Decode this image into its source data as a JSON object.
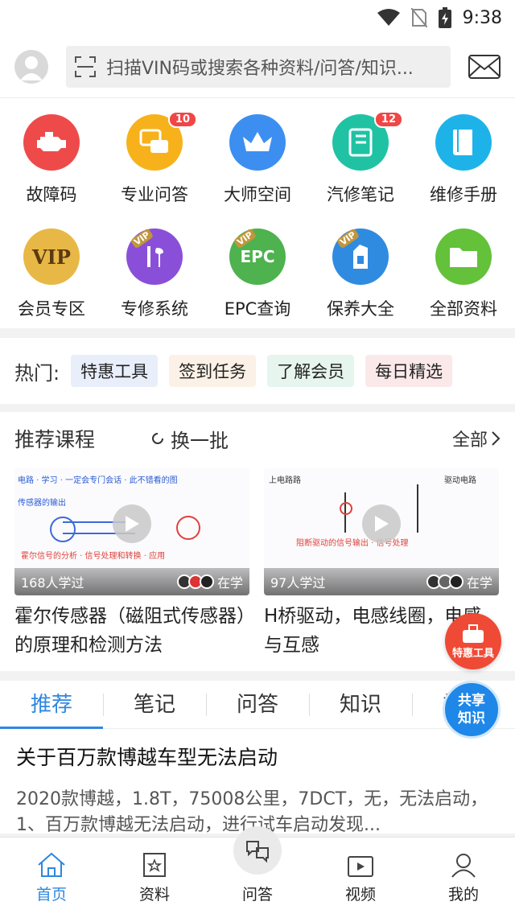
{
  "status_bar": {
    "time": "9:38"
  },
  "search": {
    "placeholder": "扫描VIN码或搜索各种资料/问答/知识..."
  },
  "grid": [
    {
      "label": "故障码",
      "icon": "engine-icon",
      "color": "#ee4a4a",
      "badge": ""
    },
    {
      "label": "专业问答",
      "icon": "chat-icon",
      "color": "#f7b21b",
      "badge": "10"
    },
    {
      "label": "大师空间",
      "icon": "crown-icon",
      "color": "#3c8ff0",
      "badge": ""
    },
    {
      "label": "汽修笔记",
      "icon": "notebook-icon",
      "color": "#1fc3a3",
      "badge": "12"
    },
    {
      "label": "维修手册",
      "icon": "book-icon",
      "color": "#1db3e8",
      "badge": ""
    },
    {
      "label": "会员专区",
      "icon": "vip-icon",
      "color": "#e8b846",
      "text": "VIP"
    },
    {
      "label": "专修系统",
      "icon": "tools-icon",
      "color": "#8a4fd8"
    },
    {
      "label": "EPC查询",
      "icon": "epc-icon",
      "color": "#4eb24e",
      "text": "EPC"
    },
    {
      "label": "保养大全",
      "icon": "oil-icon",
      "color": "#2f8be0"
    },
    {
      "label": "全部资料",
      "icon": "folder-icon",
      "color": "#63c13a"
    }
  ],
  "hot": {
    "title": "热门:",
    "chips": [
      {
        "label": "特惠工具",
        "bg": "#e9eefb",
        "color": "#444"
      },
      {
        "label": "签到任务",
        "bg": "#fbf1e6",
        "color": "#444"
      },
      {
        "label": "了解会员",
        "bg": "#e6f5ee",
        "color": "#444"
      },
      {
        "label": "每日精选",
        "bg": "#fbe9ea",
        "color": "#444"
      }
    ]
  },
  "courses": {
    "title": "推荐课程",
    "refresh": "换一批",
    "all": "全部",
    "items": [
      {
        "learners": "168人学过",
        "studying": "在学",
        "title": "霍尔传感器（磁阻式传感器）的原理和检测方法"
      },
      {
        "learners": "97人学过",
        "studying": "在学",
        "title": "H桥驱动，电感线圈，电感与互感"
      }
    ]
  },
  "float_tool": {
    "label": "特惠工具"
  },
  "float_share": {
    "line1": "共享",
    "line2": "知识"
  },
  "feed": {
    "tabs": [
      "推荐",
      "笔记",
      "问答",
      "知识",
      "视频"
    ],
    "article": {
      "title": "关于百万款博越车型无法启动",
      "summary": "2020款博越，1.8T，75008公里，7DCT，无，无法启动，1、百万款博越无法启动，进行试车启动发现..."
    }
  },
  "bottom_nav": [
    {
      "label": "首页",
      "icon": "home-icon"
    },
    {
      "label": "资料",
      "icon": "document-icon"
    },
    {
      "label": "问答",
      "icon": "qa-icon"
    },
    {
      "label": "视频",
      "icon": "video-icon"
    },
    {
      "label": "我的",
      "icon": "profile-icon"
    }
  ]
}
